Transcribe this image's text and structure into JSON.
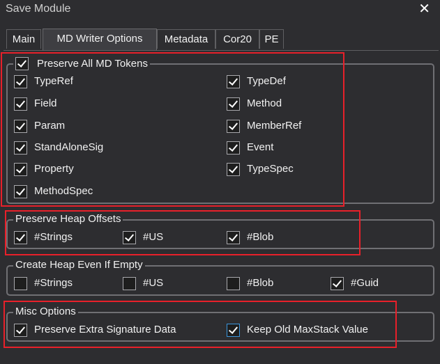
{
  "window": {
    "title": "Save Module",
    "close_glyph": "✕"
  },
  "tabs": [
    "Main",
    "MD Writer Options",
    "Metadata",
    "Cor20",
    "PE"
  ],
  "active_tab": "MD Writer Options",
  "groups": {
    "preserve_all": {
      "label": "Preserve All MD Tokens",
      "checked": true,
      "items": [
        {
          "label": "TypeRef",
          "checked": true
        },
        {
          "label": "TypeDef",
          "checked": true
        },
        {
          "label": "Field",
          "checked": true
        },
        {
          "label": "Method",
          "checked": true
        },
        {
          "label": "Param",
          "checked": true
        },
        {
          "label": "MemberRef",
          "checked": true
        },
        {
          "label": "StandAloneSig",
          "checked": true
        },
        {
          "label": "Event",
          "checked": true
        },
        {
          "label": "Property",
          "checked": true
        },
        {
          "label": "TypeSpec",
          "checked": true
        },
        {
          "label": "MethodSpec",
          "checked": true
        }
      ]
    },
    "heap_offsets": {
      "label": "Preserve Heap Offsets",
      "items": [
        {
          "label": "#Strings",
          "checked": true
        },
        {
          "label": "#US",
          "checked": true
        },
        {
          "label": "#Blob",
          "checked": true
        }
      ]
    },
    "heap_empty": {
      "label": "Create Heap Even If Empty",
      "items": [
        {
          "label": "#Strings",
          "checked": false
        },
        {
          "label": "#US",
          "checked": false
        },
        {
          "label": "#Blob",
          "checked": false
        },
        {
          "label": "#Guid",
          "checked": true
        }
      ]
    },
    "misc": {
      "label": "Misc Options",
      "items": [
        {
          "label": "Preserve Extra Signature Data",
          "checked": true
        },
        {
          "label": "Keep Old MaxStack Value",
          "checked": true
        }
      ]
    }
  },
  "colors": {
    "background": "#2d2d30",
    "border": "#707074",
    "highlight": "#e8202a",
    "focus": "#3a96dd"
  }
}
